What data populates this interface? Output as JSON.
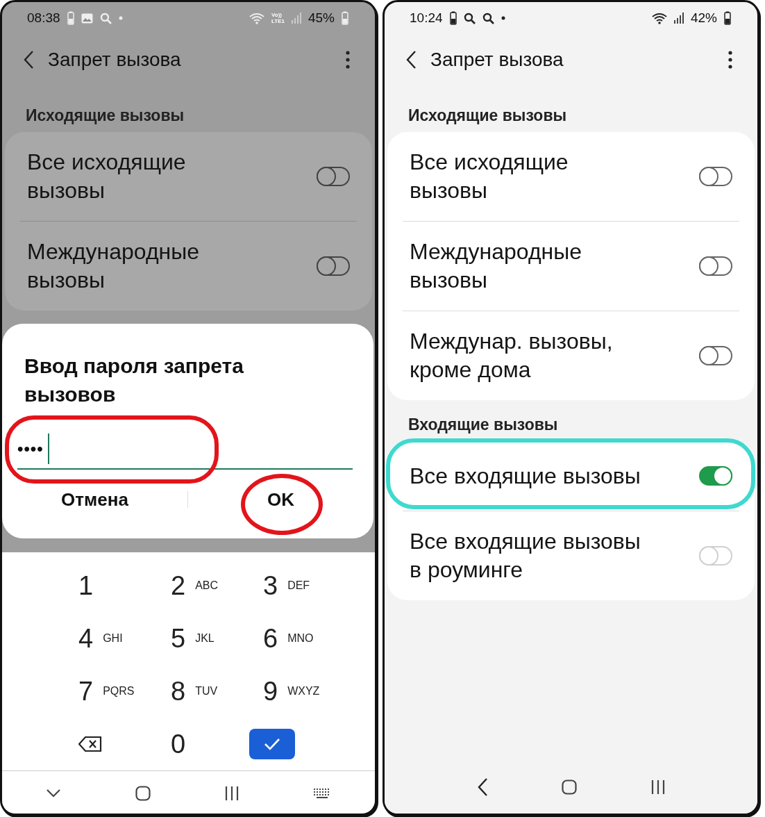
{
  "left_phone": {
    "status_bar": {
      "time": "08:38",
      "volte": "Vo))",
      "lte": "LTE1",
      "battery": "45%"
    },
    "title": "Запрет вызова",
    "section": "Исходящие вызовы",
    "items": [
      {
        "label": "Все исходящие\nвызовы",
        "on": false
      },
      {
        "label": "Международные\nвызовы",
        "on": false
      }
    ],
    "dialog": {
      "title": "Ввод пароля запрета\nвызовов",
      "value": "••••",
      "highlighted": true,
      "buttons": [
        {
          "label": "Отмена"
        },
        {
          "label": "OK",
          "highlighted": true
        }
      ]
    },
    "keypad": [
      {
        "kind": "digit",
        "digit": "1"
      },
      {
        "kind": "digit",
        "digit": "2",
        "letters": "ABC"
      },
      {
        "kind": "digit",
        "digit": "3",
        "letters": "DEF"
      },
      {
        "kind": "digit",
        "digit": "4",
        "letters": "GHI"
      },
      {
        "kind": "digit",
        "digit": "5",
        "letters": "JKL"
      },
      {
        "kind": "digit",
        "digit": "6",
        "letters": "MNO"
      },
      {
        "kind": "digit",
        "digit": "7",
        "letters": "PQRS"
      },
      {
        "kind": "digit",
        "digit": "8",
        "letters": "TUV"
      },
      {
        "kind": "digit",
        "digit": "9",
        "letters": "WXYZ"
      },
      {
        "kind": "backspace"
      },
      {
        "kind": "digit",
        "digit": "0"
      },
      {
        "kind": "done"
      }
    ]
  },
  "right_phone": {
    "status_bar": {
      "time": "10:24",
      "battery": "42%"
    },
    "title": "Запрет вызова",
    "sections": [
      {
        "title": "Исходящие вызовы",
        "items": [
          {
            "label": "Все исходящие\nвызовы",
            "on": false
          },
          {
            "label": "Международные\nвызовы",
            "on": false
          },
          {
            "label": "Междунар. вызовы,\nкроме дома",
            "on": false
          }
        ]
      },
      {
        "title": "Входящие вызовы",
        "items": [
          {
            "label": "Все входящие вызовы",
            "on": true,
            "highlighted": true
          },
          {
            "label": "Все входящие вызовы\nв роуминге",
            "on": false,
            "disabled": true
          }
        ]
      }
    ]
  }
}
